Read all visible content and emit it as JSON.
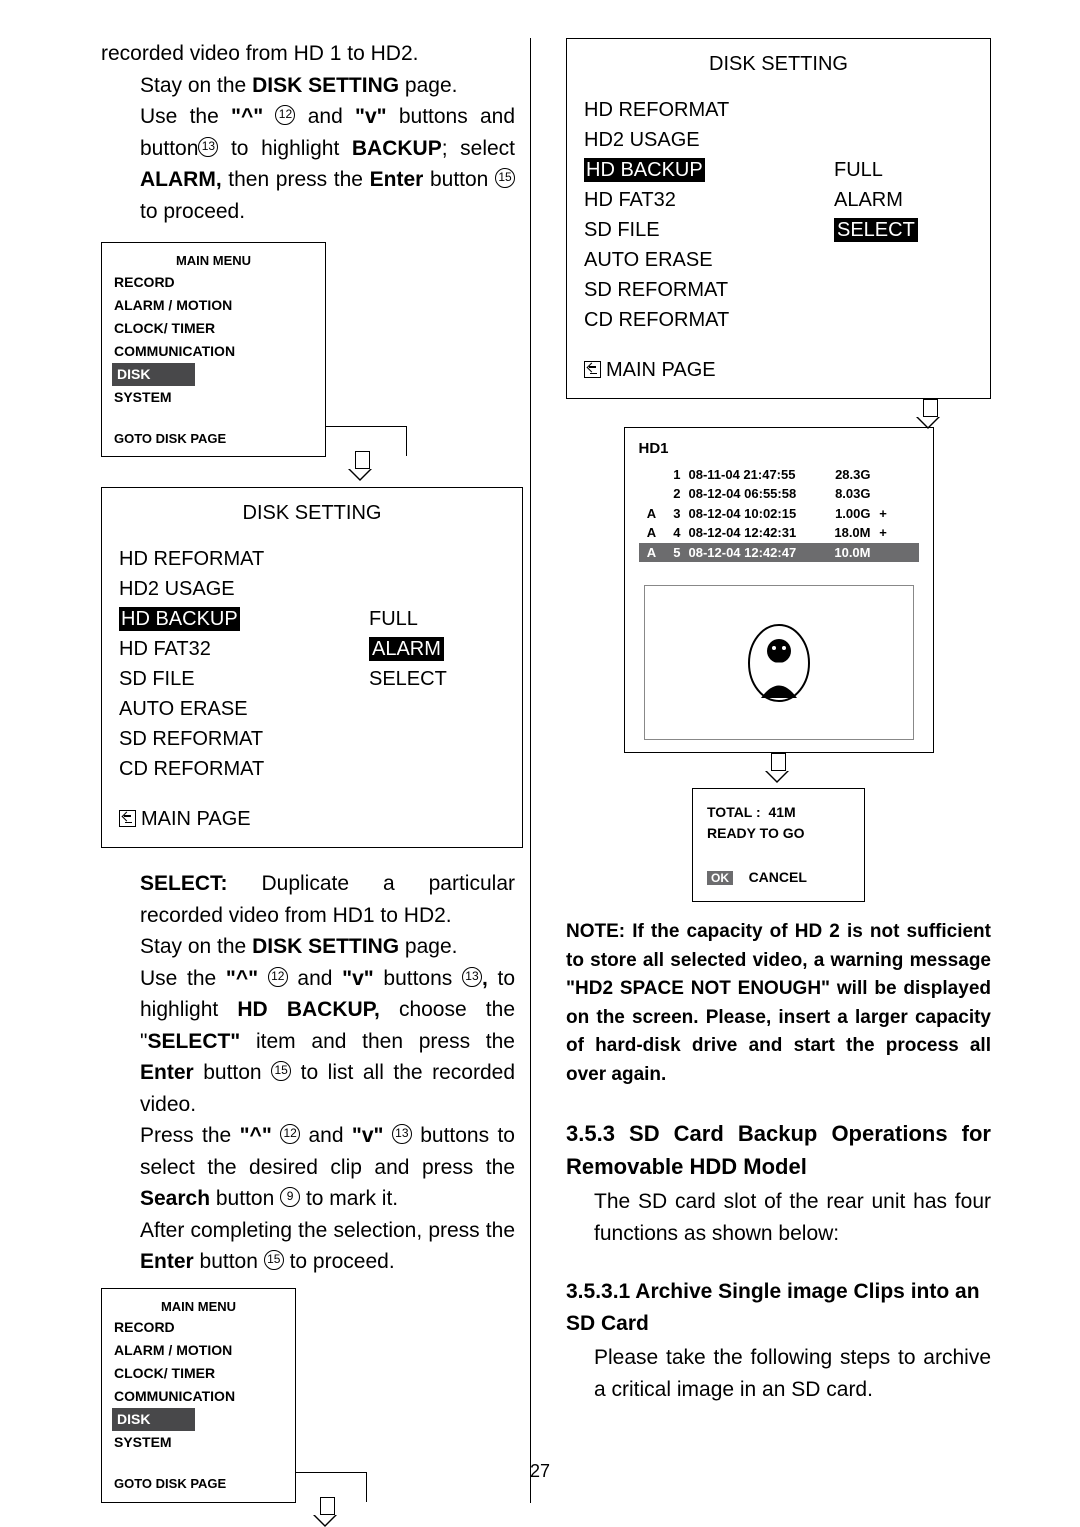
{
  "page_number": "27",
  "left": {
    "intro": "recorded video from HD 1 to HD2.",
    "p1_a": "Stay on the ",
    "p1_b": "DISK SETTING",
    "p1_c": " page.",
    "p2_a": "Use the ",
    "p2_b": "\"^\"",
    "p2_c12": "12",
    "p2_d": " and ",
    "p2_e": "\"v\"",
    "p2_f": " buttons and button",
    "p2_c13": "13",
    "p2_g": " to highlight ",
    "p2_h": "BACKUP",
    "p2_i": "; select ",
    "p2_j": "ALARM,",
    "p2_k": " then press the ",
    "p2_l": "Enter",
    "p2_m": " button ",
    "p2_c15": "15",
    "p2_n": " to proceed.",
    "menu1": {
      "title": "MAIN MENU",
      "items": [
        "RECORD",
        "ALARM / MOTION",
        "CLOCK/ TIMER",
        "COMMUNICATION",
        "DISK",
        "SYSTEM"
      ],
      "goto": "GOTO DISK PAGE"
    },
    "disk1": {
      "title": "DISK SETTING",
      "rows": [
        {
          "label": "HD REFORMAT",
          "val": ""
        },
        {
          "label": "HD2 USAGE",
          "val": ""
        },
        {
          "label": "HD BACKUP",
          "val": "FULL",
          "labelHL": true
        },
        {
          "label": "HD FAT32",
          "val": "ALARM",
          "valHL": true
        },
        {
          "label": "SD FILE",
          "val": "SELECT"
        },
        {
          "label": "AUTO ERASE",
          "val": ""
        },
        {
          "label": "SD REFORMAT",
          "val": ""
        },
        {
          "label": "CD REFORMAT",
          "val": ""
        }
      ],
      "main": "MAIN PAGE"
    },
    "p3_a": "SELECT:",
    "p3_b": " Duplicate a particular recorded video from HD1 to HD2.",
    "p4_a": "Stay on the ",
    "p4_b": "DISK SETTING",
    "p4_c": " page.",
    "p5_a": "Use the ",
    "p5_b": "\"^\"",
    "p5_c12": "12",
    "p5_d": " and ",
    "p5_e": "\"v\"",
    "p5_f": " buttons ",
    "p5_c13": "13",
    "p5_g": ", ",
    "p5_h": "to highlight ",
    "p5_i": "HD BACKUP,",
    "p5_j": " choose the \"",
    "p5_k": "SELECT\"",
    "p5_l": " item and then press the ",
    "p5_m": "Enter",
    "p5_n": " button ",
    "p5_c15": "15",
    "p5_o": " to list all the recorded video.",
    "p6_a": "Press the ",
    "p6_b": "\"^\"",
    "p6_c12": "12",
    "p6_d": " and ",
    "p6_e": "\"v\"",
    "p6_c13": "13",
    "p6_f": " buttons to select the desired clip and press the ",
    "p6_g": "Search",
    "p6_h": " button ",
    "p6_c9": "9",
    "p6_i": " to mark it.",
    "p7_a": "After completing the selection, press the ",
    "p7_b": "Enter",
    "p7_c": " button ",
    "p7_c15": "15",
    "p7_d": " to proceed."
  },
  "right": {
    "disk2": {
      "title": "DISK SETTING",
      "rows": [
        {
          "label": "HD REFORMAT",
          "val": ""
        },
        {
          "label": "HD2 USAGE",
          "val": ""
        },
        {
          "label": "HD BACKUP",
          "val": "FULL",
          "labelHL": true
        },
        {
          "label": "HD FAT32",
          "val": "ALARM"
        },
        {
          "label": "SD FILE",
          "val": "SELECT",
          "valHL": true
        },
        {
          "label": "AUTO ERASE",
          "val": ""
        },
        {
          "label": "SD REFORMAT",
          "val": ""
        },
        {
          "label": "CD REFORMAT",
          "val": ""
        }
      ],
      "main": "MAIN PAGE"
    },
    "hd1": {
      "title": "HD1",
      "rows": [
        {
          "a": "",
          "n": "1",
          "ts": "08-11-04 21:47:55",
          "sz": "28.3G",
          "m": ""
        },
        {
          "a": "",
          "n": "2",
          "ts": "08-12-04 06:55:58",
          "sz": "8.03G",
          "m": ""
        },
        {
          "a": "A",
          "n": "3",
          "ts": "08-12-04 10:02:15",
          "sz": "1.00G",
          "m": "+"
        },
        {
          "a": "A",
          "n": "4",
          "ts": "08-12-04 12:42:31",
          "sz": "18.0M",
          "m": "+"
        },
        {
          "a": "A",
          "n": "5",
          "ts": "08-12-04 12:42:47",
          "sz": "10.0M",
          "m": "",
          "sel": true
        }
      ]
    },
    "result": {
      "total_lbl": "TOTAL :",
      "total_val": "41M",
      "status": "READY TO GO",
      "ok": "OK",
      "cancel": "CANCEL"
    },
    "note_a": "NOTE:",
    "note_b": " If the capacity of HD 2 is not sufficient to store all selected video, a warning message \"HD2 SPACE NOT ENOUGH\" will be displayed on the screen. Please, insert a larger capacity of hard-disk drive and start the process all over again.",
    "sec_title": "3.5.3 SD Card Backup Operations for Removable HDD Model",
    "sec_body": "The SD card slot of the rear unit has four functions as shown below:",
    "sub_title": "3.5.3.1 Archive Single image Clips into an SD Card",
    "sub_body": "Please take the following steps to archive a critical image in an SD card."
  }
}
